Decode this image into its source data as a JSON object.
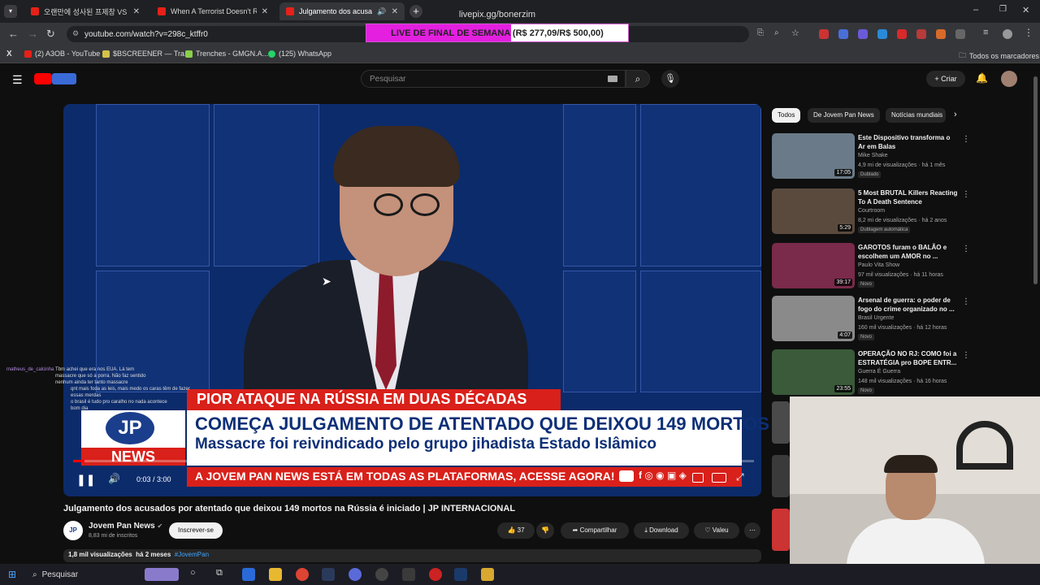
{
  "browser": {
    "tabs": [
      {
        "label": "오랜만에 성사된 프제창 VS 페이"
      },
      {
        "label": "When A Terrorist Doesn't Realize"
      },
      {
        "label": "Julgamento dos acusados p"
      }
    ],
    "new_tab": "+",
    "url": "youtube.com/watch?v=298c_ktffr0",
    "bookmarks": [
      {
        "label": "(2) A3OB - YouTube"
      },
      {
        "label": "$BSCREENER — Tra..."
      },
      {
        "label": "Trenches - GMGN.A..."
      },
      {
        "label": "(125) WhatsApp"
      }
    ],
    "all_bookmarks": "Todos os marcadores"
  },
  "overlay": {
    "livepix_url": "livepix.gg/bonerzim",
    "donation_label": "LIVE DE FINAL DE SEMANA (R$ 277,09/R$ 500,00)",
    "donation_progress": 0.5542
  },
  "youtube": {
    "search_placeholder": "Pesquisar",
    "create_label": "Criar",
    "video": {
      "headline_tag": "PIOR ATAQUE NA RÚSSIA EM DUAS DÉCADAS",
      "headline_title": "COMEÇA JULGAMENTO DE ATENTADO QUE DEIXOU 149 MORTOS",
      "headline_sub": "Massacre foi reivindicado pelo grupo jihadista Estado Islâmico",
      "ticker": "A JOVEM PAN NEWS ESTÁ EM TODAS AS PLATAFORMAS, ACESSE AGORA!",
      "logo_top": "JP",
      "logo_bottom": "NEWS",
      "time": "0:03 / 3:00",
      "progress": 0.017
    },
    "title": "Julgamento dos acusados por atentado que deixou 149 mortos na Rússia é iniciado | JP INTERNACIONAL",
    "channel": {
      "name": "Jovem Pan News",
      "subscribers": "8,83 mi de inscritos",
      "subscribe": "Inscrever-se"
    },
    "actions": {
      "likes": "37",
      "share": "Compartilhar",
      "download": "Download",
      "thanks": "Valeu"
    },
    "meta": {
      "views": "1,8 mil visualizações",
      "age": "há 2 meses",
      "hashtag": "#JovemPan"
    },
    "chips": [
      "Todos",
      "De Jovem Pan News",
      "Notícias mundiais"
    ],
    "recommendations": [
      {
        "title": "Este Dispositivo transforma o Ar em Balas",
        "channel": "Mike Shake",
        "stats": "4,9 mi de visualizações · há 1 mês",
        "badge": "Dublado",
        "duration": "17:05",
        "thumb_color": "#6a7a88"
      },
      {
        "title": "5 Most BRUTAL Killers Reacting To A Death Sentence",
        "channel": "Courtroom",
        "stats": "8,2 mi de visualizações · há 2 anos",
        "badge": "Dublagem automática",
        "duration": "5:29",
        "thumb_color": "#5a4a3e"
      },
      {
        "title": "GAROTOS furam o BALÃO e escolhem um AMOR no ...",
        "channel": "Paulo Vita Show",
        "stats": "97 mil visualizações · há 11 horas",
        "badge": "Novo",
        "duration": "39:17",
        "thumb_color": "#7a2a4a"
      },
      {
        "title": "Arsenal de guerra: o poder de fogo do crime organizado no ...",
        "channel": "Brasil Urgente",
        "stats": "160 mil visualizações · há 12 horas",
        "badge": "Novo",
        "duration": "4:07",
        "thumb_color": "#8a8a8a"
      },
      {
        "title": "OPERAÇÃO NO RJ: COMO foi a ESTRATÉGIA pro BOPE ENTR...",
        "channel": "Guerra É Guerra",
        "stats": "148 mil visualizações · há 16 horas",
        "badge": "Novo",
        "duration": "23:55",
        "thumb_color": "#3a5a3a"
      }
    ]
  },
  "chat": [
    {
      "user": "matheus_de_calcinha",
      "msg": "Tbm achei que era nos EUA. Lá tem massacre que só a porra. Não faz sentido nenhum ainda ter tanto massacre"
    },
    {
      "user": "",
      "msg": "qnt mais foda as leis, mais medo os caras têm de fazer essas merdas"
    },
    {
      "user": "",
      "msg": "o brasil é tudo pro caralho no nada acontece"
    },
    {
      "user": "",
      "msg": "bom dia"
    }
  ],
  "taskbar": {
    "search": "Pesquisar"
  },
  "colors": {
    "youtube_red": "#ff0000",
    "jp_red": "#d9201a",
    "jp_blue": "#0d2f76",
    "donation_pink": "#e41fe0"
  }
}
